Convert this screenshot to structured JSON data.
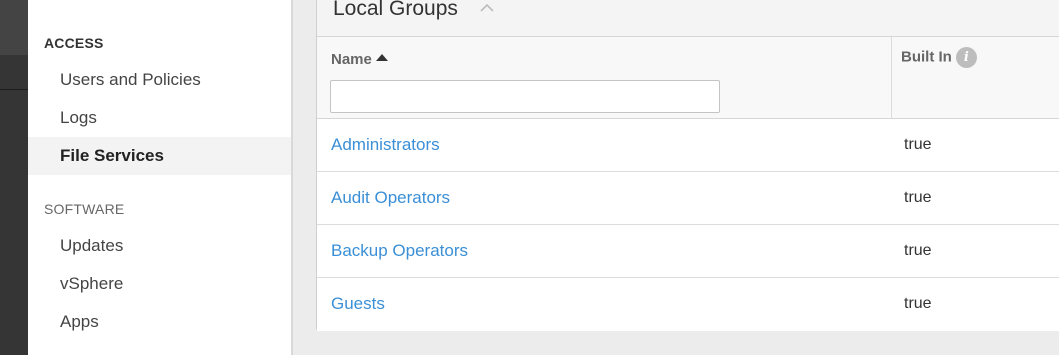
{
  "sidebar": {
    "sections": [
      {
        "title": "ACCESS",
        "items": [
          {
            "label": "Users and Policies"
          },
          {
            "label": "Logs"
          },
          {
            "label": "File Services"
          }
        ]
      },
      {
        "title": "SOFTWARE",
        "items": [
          {
            "label": "Updates"
          },
          {
            "label": "vSphere"
          },
          {
            "label": "Apps"
          }
        ]
      }
    ],
    "active_item": "File Services"
  },
  "panel": {
    "title": "Local Groups",
    "columns": {
      "name": "Name",
      "built_in": "Built In"
    },
    "filter": {
      "value": "",
      "placeholder": ""
    },
    "rows": [
      {
        "name": "Administrators",
        "built_in": "true"
      },
      {
        "name": "Audit Operators",
        "built_in": "true"
      },
      {
        "name": "Backup Operators",
        "built_in": "true"
      },
      {
        "name": "Guests",
        "built_in": "true"
      }
    ]
  },
  "colors": {
    "link": "#3a8fd6",
    "rail": "#353535",
    "active_bg": "#f3f3f3"
  },
  "icons": {
    "collapse": "chevron-up-icon",
    "sort": "sort-ascending-icon",
    "info": "info-icon"
  }
}
